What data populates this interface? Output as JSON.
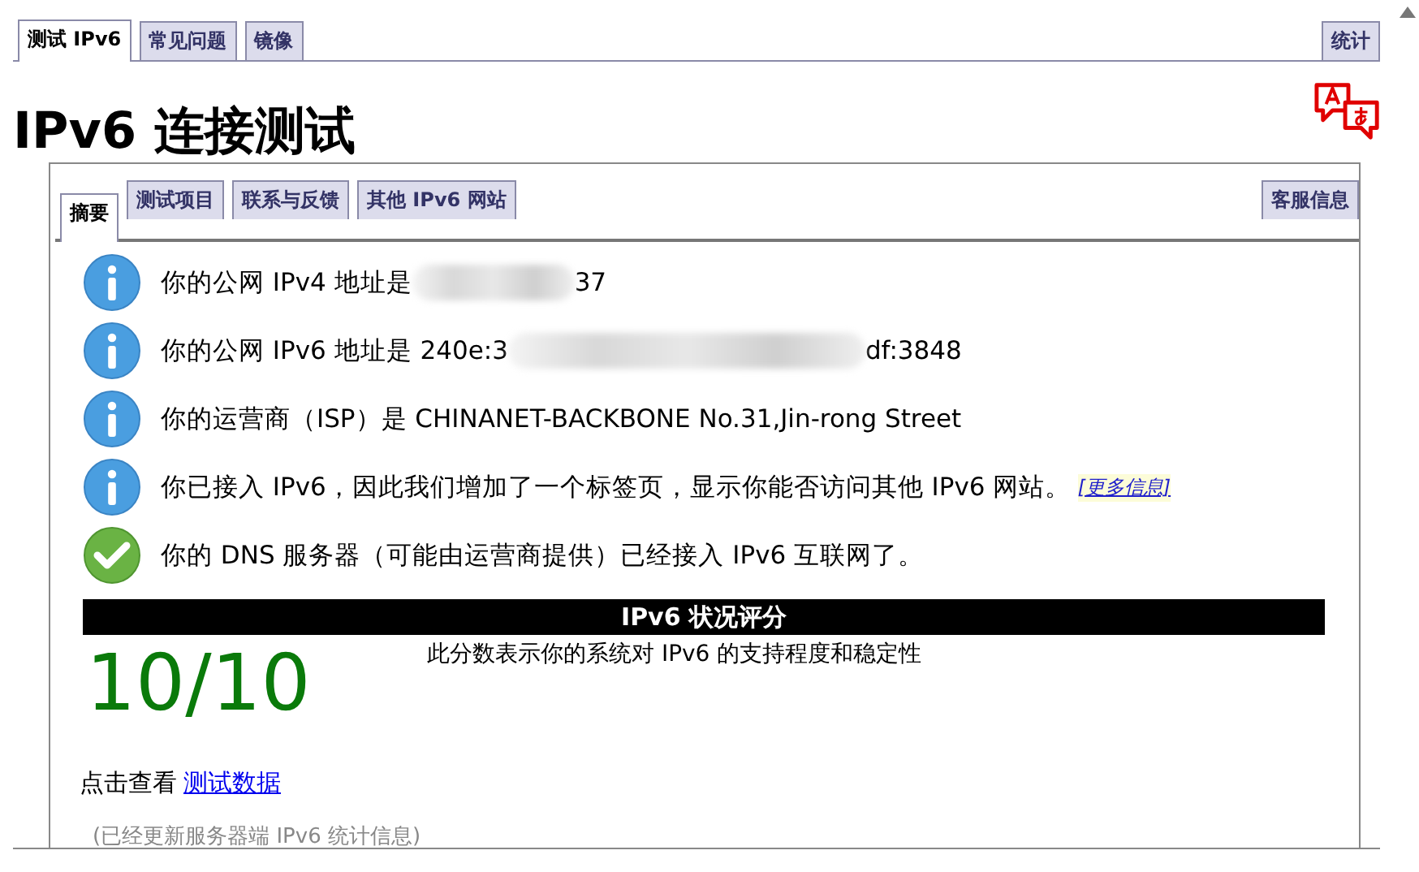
{
  "top_tabs": [
    {
      "label": "测试 IPv6",
      "selected": true
    },
    {
      "label": "常见问题",
      "selected": false
    },
    {
      "label": "镜像",
      "selected": false
    }
  ],
  "top_right_tab": {
    "label": "统计",
    "selected": false
  },
  "title": "IPv6 连接测试",
  "inner_tabs": [
    {
      "label": "摘要",
      "selected": true
    },
    {
      "label": "测试项目",
      "selected": false
    },
    {
      "label": "联系与反馈",
      "selected": false
    },
    {
      "label": "其他 IPv6 网站",
      "selected": false
    }
  ],
  "inner_right_tab": {
    "label": "客服信息",
    "selected": false
  },
  "messages": [
    {
      "kind": "info",
      "prefix": "你的公网 IPv4 地址是",
      "redacted": true,
      "suffix": "37"
    },
    {
      "kind": "info",
      "prefix": "你的公网 IPv6 地址是 240e:3",
      "redacted": true,
      "suffix": "df:3848"
    },
    {
      "kind": "info",
      "prefix": "你的运营商（ISP）是 CHINANET-BACKBONE No.31,Jin-rong Street",
      "redacted": false
    },
    {
      "kind": "info",
      "prefix": "你已接入 IPv6，因此我们增加了一个标签页，显示你能否访问其他 IPv6 网站。",
      "redacted": false,
      "link": "[更多信息]"
    },
    {
      "kind": "ok",
      "prefix": "你的 DNS 服务器（可能由运营商提供）已经接入 IPv6 互联网了。",
      "redacted": false
    }
  ],
  "score": {
    "heading": "IPv6 状况评分",
    "value": "10/10",
    "description": "此分数表示你的系统对 IPv6 的支持程度和稳定性"
  },
  "details": {
    "label": "点击查看",
    "link": "测试数据"
  },
  "note": "(已经更新服务器端 IPv6 统计信息)"
}
